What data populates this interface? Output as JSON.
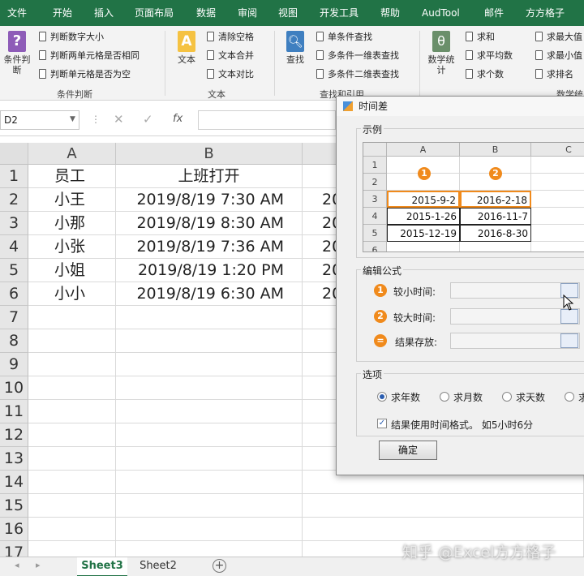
{
  "ribbon_tabs": [
    "文件",
    "开始",
    "插入",
    "页面布局",
    "数据",
    "审阅",
    "视图",
    "开发工具",
    "帮助",
    "AudTool",
    "邮件",
    "方方格子"
  ],
  "ribbon": {
    "condition_group": {
      "big_button": "条件判断",
      "items": [
        "判断数字大小",
        "判断两单元格是否相同",
        "判断单元格是否为空"
      ],
      "label": "条件判断"
    },
    "text_group": {
      "big_button": "文本",
      "items": [
        "清除空格",
        "文本合并",
        "文本对比"
      ],
      "label": "文本"
    },
    "lookup_group": {
      "big_button": "查找",
      "items": [
        "单条件查找",
        "多条件一维表查找",
        "多条件二维表查找"
      ],
      "label": "查找和引用"
    },
    "stats_group": {
      "big_button": "数学统计",
      "items": [
        "求和",
        "求平均数",
        "求个数"
      ],
      "more_items": [
        "求最大值",
        "求最小值",
        "求排名"
      ],
      "label": "数学统"
    }
  },
  "formula_bar": {
    "name_box": "D2",
    "fx": "fx"
  },
  "sheet": {
    "columns": [
      "A",
      "B"
    ],
    "rows": [
      {
        "n": "1",
        "a": "员工",
        "b": "上班打开",
        "c": ""
      },
      {
        "n": "2",
        "a": "小王",
        "b": "2019/8/19 7:30 AM",
        "c": "20"
      },
      {
        "n": "3",
        "a": "小那",
        "b": "2019/8/19 8:30 AM",
        "c": "20"
      },
      {
        "n": "4",
        "a": "小张",
        "b": "2019/8/19 7:36 AM",
        "c": "20"
      },
      {
        "n": "5",
        "a": "小姐",
        "b": "2019/8/19 1:20 PM",
        "c": "20"
      },
      {
        "n": "6",
        "a": "小小",
        "b": "2019/8/19 6:30 AM",
        "c": "20"
      },
      {
        "n": "7",
        "a": "",
        "b": "",
        "c": ""
      },
      {
        "n": "8",
        "a": "",
        "b": "",
        "c": ""
      },
      {
        "n": "9",
        "a": "",
        "b": "",
        "c": ""
      },
      {
        "n": "10",
        "a": "",
        "b": "",
        "c": ""
      },
      {
        "n": "11",
        "a": "",
        "b": "",
        "c": ""
      },
      {
        "n": "12",
        "a": "",
        "b": "",
        "c": ""
      },
      {
        "n": "13",
        "a": "",
        "b": "",
        "c": ""
      },
      {
        "n": "14",
        "a": "",
        "b": "",
        "c": ""
      },
      {
        "n": "15",
        "a": "",
        "b": "",
        "c": ""
      },
      {
        "n": "16",
        "a": "",
        "b": "",
        "c": ""
      },
      {
        "n": "17",
        "a": "",
        "b": "",
        "c": ""
      }
    ]
  },
  "sheet_tabs": [
    "Sheet3",
    "Sheet2"
  ],
  "dialog": {
    "title": "时间差",
    "example_legend": "示例",
    "example": {
      "columns": [
        "A",
        "B",
        "C"
      ],
      "rows": [
        {
          "n": "1",
          "a": "",
          "b": ""
        },
        {
          "n": "2",
          "a": "",
          "b": ""
        },
        {
          "n": "3",
          "a": "2015-9-2",
          "b": "2016-2-18"
        },
        {
          "n": "4",
          "a": "2015-1-26",
          "b": "2016-11-7"
        },
        {
          "n": "5",
          "a": "2015-12-19",
          "b": "2016-8-30"
        },
        {
          "n": "6",
          "a": "",
          "b": ""
        }
      ],
      "marker_a": "1",
      "marker_b": "2"
    },
    "formula_legend": "编辑公式",
    "fields": [
      {
        "marker": "1",
        "label": "较小时间:"
      },
      {
        "marker": "2",
        "label": "较大时间:"
      },
      {
        "marker": "=",
        "label": "结果存放:"
      }
    ],
    "options_legend": "选项",
    "radios": [
      "求年数",
      "求月数",
      "求天数",
      "求"
    ],
    "checkbox_label": "结果使用时间格式。 如5小时6分",
    "ok": "确定"
  },
  "watermark": "知乎 @Excel方方格子",
  "colors": {
    "accent": "#217346",
    "marker": "#f08a1c"
  }
}
